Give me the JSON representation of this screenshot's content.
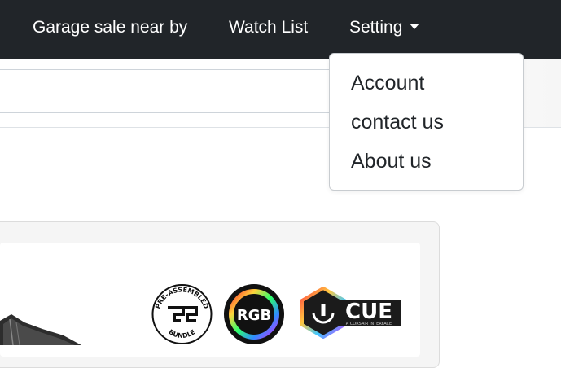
{
  "navbar": {
    "items": [
      {
        "label": "Garage sale near by"
      },
      {
        "label": "Watch List"
      },
      {
        "label": "Setting"
      }
    ]
  },
  "settings_menu": {
    "items": [
      {
        "label": "Account"
      },
      {
        "label": "contact us"
      },
      {
        "label": "About us"
      }
    ]
  },
  "product": {
    "badges": {
      "bundle_top": "PRE-ASSEMBLED",
      "bundle_bottom": "BUNDLE",
      "rgb": "RGB",
      "cue": "CUE",
      "cue_sub": "A CORSAIR INTERFACE"
    }
  },
  "colors": {
    "navbar_bg": "#212529",
    "nav_text": "#ffffff",
    "menu_text": "#212529"
  }
}
